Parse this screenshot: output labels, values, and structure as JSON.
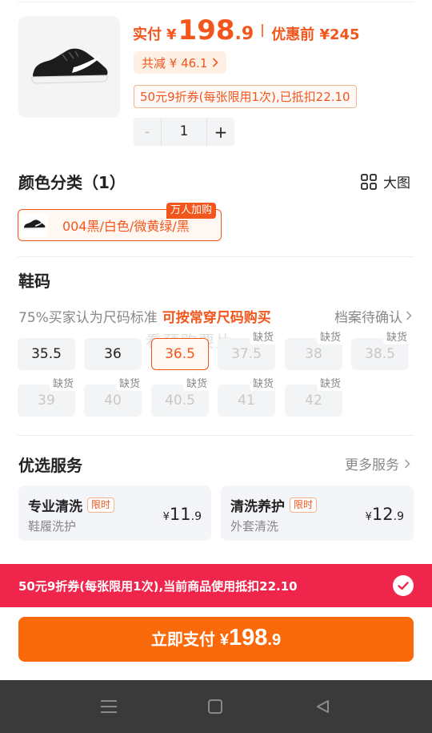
{
  "product": {
    "image_icon": "sneaker-icon",
    "price_prefix": "实付",
    "currency": "¥",
    "price_int": "198",
    "price_dec": ".9",
    "original_price": "优惠前 ¥245",
    "total_discount": "共减 ¥ 46.1",
    "coupon_applied": "50元9折券(每张限用1次),已抵扣22.10"
  },
  "quantity": {
    "minus": "-",
    "value": "1",
    "plus": "+"
  },
  "color_section": {
    "title": "颜色分类（1）",
    "big_view": "大图",
    "option_label": "004黑/白色/微黄绿/黑",
    "badge": "万人加购"
  },
  "size_section": {
    "title": "鞋码",
    "fit_text": "75%买家认为尺码标准",
    "fit_hint": "可按常穿尺码购买",
    "fit_more": "档案待确认",
    "watermark": "看预购要片",
    "out_of_stock": "缺货",
    "sizes": [
      "35.5",
      "36",
      "36.5",
      "37.5",
      "38",
      "38.5",
      "39",
      "40",
      "40.5",
      "41",
      "42"
    ],
    "available": [
      true,
      true,
      true,
      false,
      false,
      false,
      false,
      false,
      false,
      false,
      false
    ],
    "selected": "36.5"
  },
  "services": {
    "title": "优选服务",
    "more": "更多服务",
    "items": [
      {
        "title": "专业清洗",
        "tag": "限时",
        "sub": "鞋履洗护",
        "yen": "¥",
        "int": "11",
        "dec": ".9"
      },
      {
        "title": "清洗养护",
        "tag": "限时",
        "sub": "外套清洗",
        "yen": "¥",
        "int": "12",
        "dec": ".9"
      }
    ]
  },
  "coupon_banner": {
    "text": "50元9折券(每张限用1次),当前商品使用抵扣22.10",
    "checked": true
  },
  "pay_button": {
    "label": "立即支付",
    "yen": "¥",
    "int": "198",
    "dec": ".9"
  },
  "colors": {
    "accent": "#f2561d",
    "pay": "#fb6a0a",
    "banner": "#f0254b",
    "navbar": "#3a3a3a"
  }
}
